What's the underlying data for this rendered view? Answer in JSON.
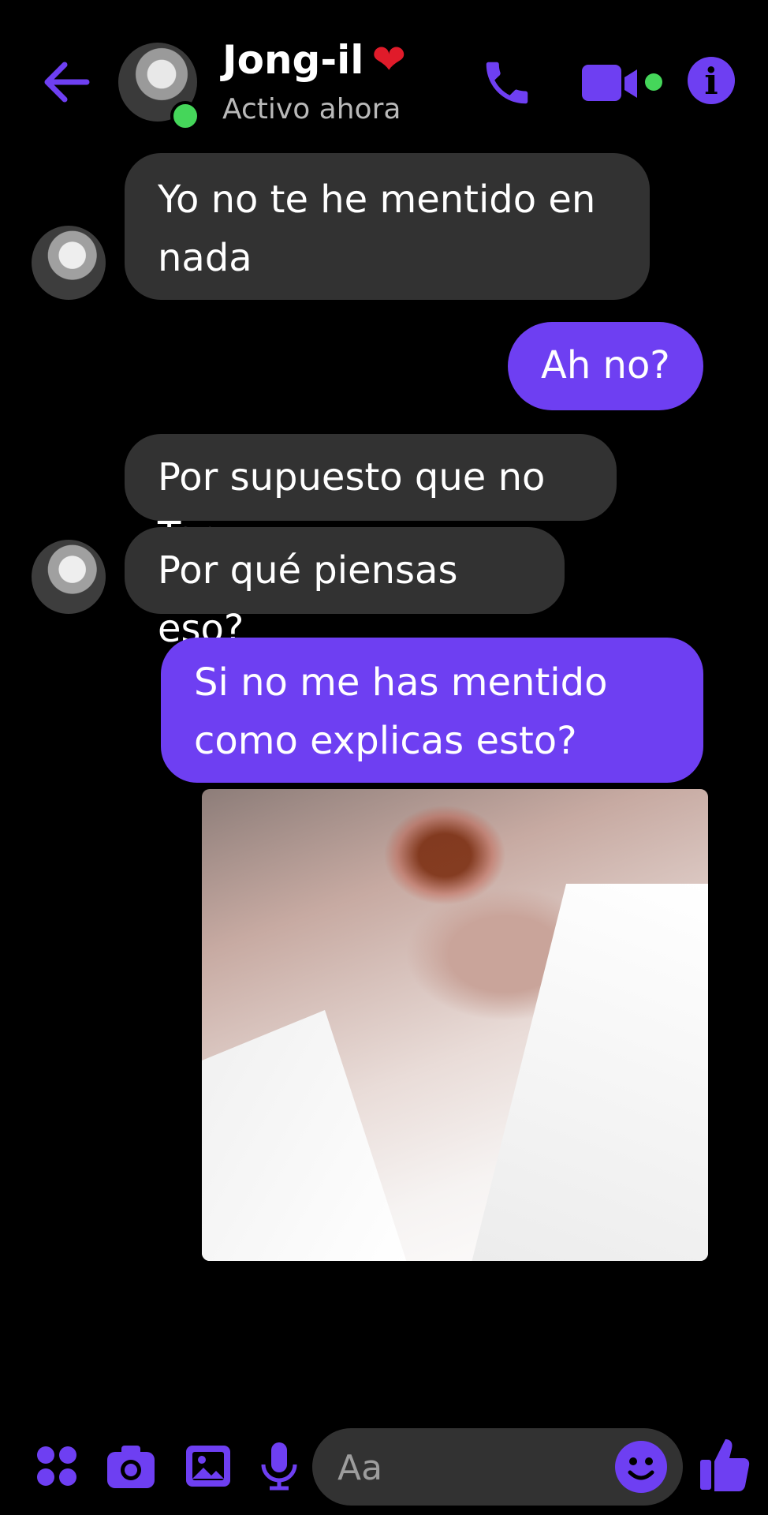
{
  "colors": {
    "accent": "#6e3ff2",
    "incoming_bubble": "#323232",
    "online": "#45d65a",
    "heart": "#e01b2a"
  },
  "header": {
    "contact_name": "Jong-il",
    "heart": "❤",
    "status": "Activo ahora",
    "icons": [
      "back-arrow-icon",
      "phone-icon",
      "video-camera-icon",
      "info-icon"
    ]
  },
  "messages": [
    {
      "from": "contact",
      "text": "Yo no te he mentido en nada"
    },
    {
      "from": "me",
      "text": "Ah no?"
    },
    {
      "from": "contact",
      "text": "Por supuesto que no Tae"
    },
    {
      "from": "contact",
      "text": "Por qué piensas eso?"
    },
    {
      "from": "me",
      "text": "Si no me has mentido como explicas esto?"
    },
    {
      "from": "me",
      "type": "image"
    }
  ],
  "composer": {
    "placeholder": "Aa",
    "icons": [
      "apps-grid-icon",
      "camera-icon",
      "gallery-icon",
      "microphone-icon",
      "emoji-icon",
      "thumbs-up-icon"
    ]
  },
  "info_glyph": "i"
}
